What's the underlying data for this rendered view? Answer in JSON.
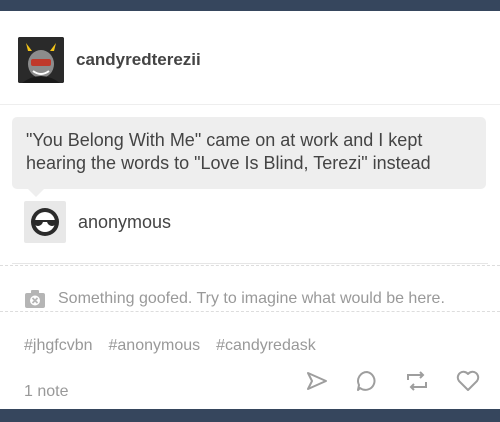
{
  "post": {
    "username": "candyredterezii",
    "ask": {
      "question": "\"You Belong With Me\" came on at work and I kept hearing the words to \"Love Is Blind, Terezi\" instead",
      "asker": "anonymous"
    },
    "media_error": "Something goofed. Try to imagine what would be here.",
    "tags": [
      "#jhgfcvbn",
      "#anonymous",
      "#candyredask"
    ],
    "notes": "1 note",
    "actions": [
      {
        "icon": "share-icon"
      },
      {
        "icon": "reply-icon"
      },
      {
        "icon": "reblog-icon"
      },
      {
        "icon": "like-icon"
      }
    ]
  },
  "colors": {
    "background": "#36465d",
    "card": "#ffffff",
    "text": "#444444",
    "muted": "#999999",
    "bubble": "#eeeeee"
  }
}
